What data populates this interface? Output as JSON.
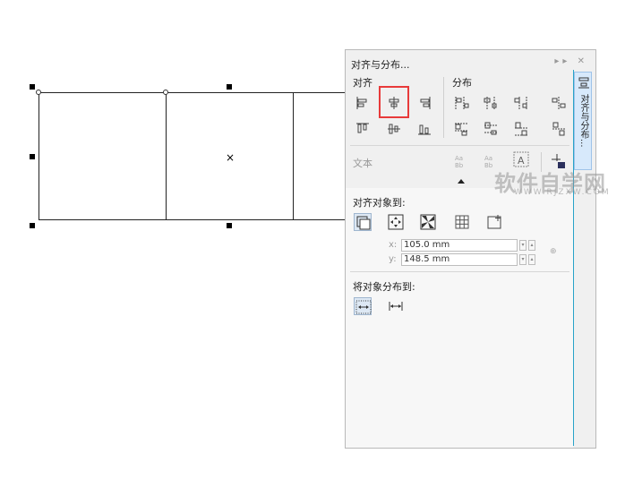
{
  "panel": {
    "title": "对齐与分布...",
    "title_buttons": "▸▸ ✕",
    "tab_label": "对齐与分布..."
  },
  "align": {
    "heading": "对齐",
    "buttons": [
      "align-left",
      "align-center-horizontal",
      "align-right",
      "align-top",
      "align-center-vertical",
      "align-bottom"
    ]
  },
  "distribute": {
    "heading": "分布",
    "buttons": [
      "distribute-left",
      "distribute-center-h",
      "distribute-right",
      "distribute-spacing-h",
      "distribute-top",
      "distribute-center-v",
      "distribute-bottom",
      "distribute-spacing-v"
    ]
  },
  "text": {
    "label": "文本",
    "buttons": [
      "text-baseline-first",
      "text-baseline-last",
      "text-bounding-box",
      "outline"
    ]
  },
  "align_to": {
    "heading": "对齐对象到:",
    "buttons": [
      "active-objects",
      "page-edge",
      "page-center",
      "grid",
      "specified-point"
    ],
    "x_label": "x:",
    "x_value": "105.0 mm",
    "y_label": "y:",
    "y_value": "148.5 mm"
  },
  "distribute_to": {
    "heading": "将对象分布到:",
    "buttons": [
      "selection-extent",
      "page-extent"
    ]
  },
  "watermark": {
    "text": "软件自学网",
    "sub": "WWW.RJZXW.COM"
  },
  "colors": {
    "highlight": "#e83a3a",
    "accent": "#28a3c9"
  }
}
